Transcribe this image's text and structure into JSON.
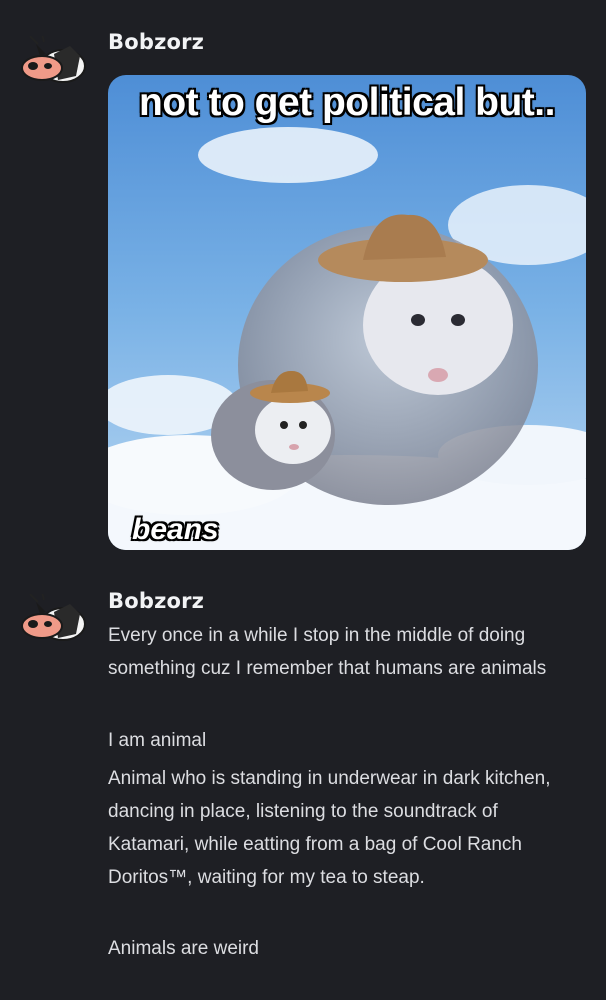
{
  "messages": [
    {
      "username": "Bobzorz",
      "avatar_icon": "opossum-avatar-icon",
      "attachment": {
        "top_caption": "not to get political but..",
        "bottom_caption": "beans"
      }
    },
    {
      "username": "Bobzorz",
      "avatar_icon": "opossum-avatar-icon",
      "paragraphs": [
        "Every once in a while I stop in the middle of doing something cuz I remember that humans are animals",
        "I am animal",
        "Animal who is standing in underwear in dark kitchen, dancing in place, listening to the soundtrack of Katamari, while eatting from a bag of Cool Ranch Doritos™, waiting for my tea to steap.",
        "Animals are weird"
      ]
    }
  ],
  "colors": {
    "background": "#1e1f24",
    "username": "#f2f3f5",
    "text": "#dcdde1",
    "sky": "#6fa6de"
  }
}
